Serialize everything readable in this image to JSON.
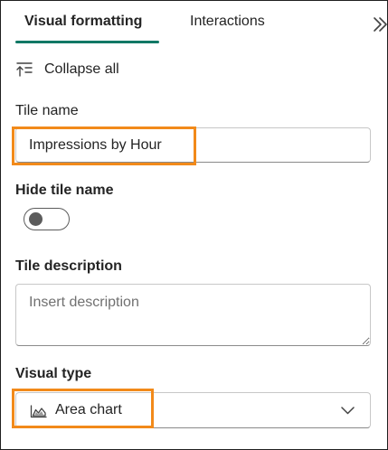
{
  "tabs": {
    "visual_formatting": "Visual formatting",
    "interactions": "Interactions",
    "accent_color": "#117865"
  },
  "collapse_all": {
    "label": "Collapse all",
    "icon": "collapse-all-icon"
  },
  "expand_icon": "double-chevron-right-icon",
  "tile_name": {
    "label": "Tile name",
    "value": "Impressions by Hour"
  },
  "hide_tile_name": {
    "label": "Hide tile name",
    "state": "off"
  },
  "tile_description": {
    "label": "Tile description",
    "placeholder": "Insert description",
    "value": ""
  },
  "visual_type": {
    "label": "Visual type",
    "selected": "Area chart",
    "icon": "area-chart-icon"
  },
  "highlight_color": "#f28a1a"
}
